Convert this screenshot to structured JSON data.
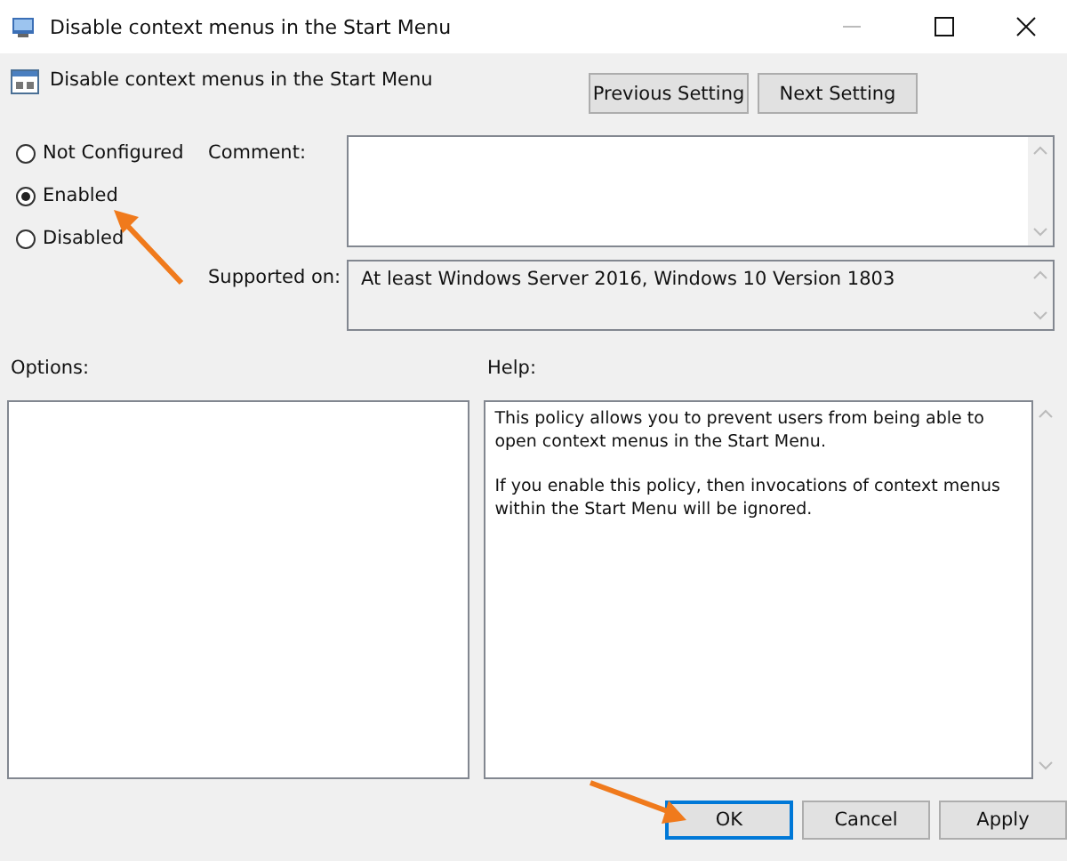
{
  "window": {
    "title": "Disable context menus in the Start Menu"
  },
  "setting_title": "Disable context menus in the Start Menu",
  "nav_buttons": [
    "Previous Setting",
    "Next Setting"
  ],
  "states": [
    {
      "label": "Not Configured",
      "selected": false
    },
    {
      "label": "Enabled",
      "selected": true
    },
    {
      "label": "Disabled",
      "selected": false
    }
  ],
  "comment": {
    "label": "Comment:"
  },
  "supported_on": {
    "label": "Supported on:",
    "value": "At least Windows Server 2016, Windows 10 Version 1803"
  },
  "options": {
    "label": "Options:"
  },
  "help": {
    "label": "Help:",
    "paragraphs": [
      "This policy allows you to prevent users from being able to open context menus in the Start Menu.",
      "If you enable this policy, then invocations of context menus within the Start Menu will be ignored."
    ]
  },
  "buttons": [
    {
      "label": "OK",
      "default": true
    },
    {
      "label": "Cancel",
      "default": false
    },
    {
      "label": "Apply",
      "default": false
    }
  ]
}
